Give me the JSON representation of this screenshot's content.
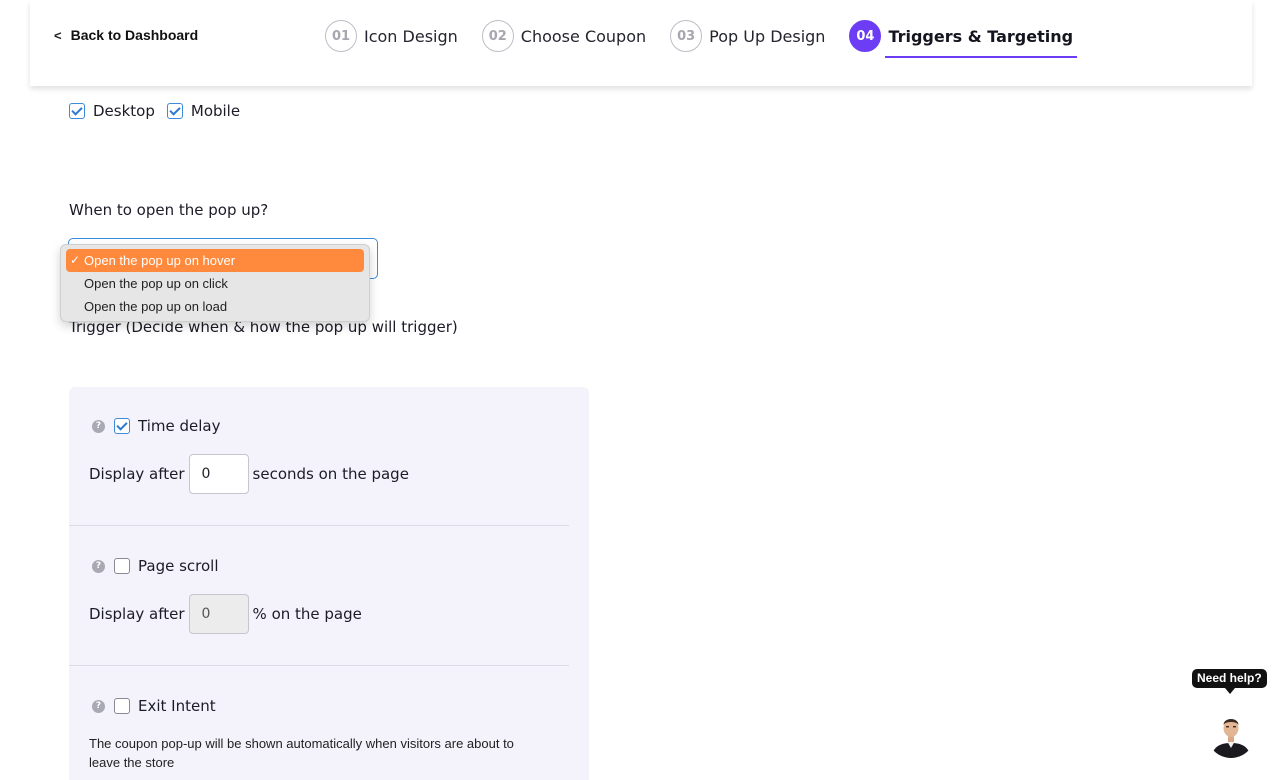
{
  "header": {
    "back_label": "Back to Dashboard",
    "steps": [
      {
        "num": "01",
        "label": "Icon Design"
      },
      {
        "num": "02",
        "label": "Choose Coupon"
      },
      {
        "num": "03",
        "label": "Pop Up Design"
      },
      {
        "num": "04",
        "label": "Triggers & Targeting"
      }
    ],
    "active_step": 3,
    "accent_color": "#6c3df5"
  },
  "devices": [
    {
      "label": "Desktop",
      "checked": true
    },
    {
      "label": "Mobile",
      "checked": true
    }
  ],
  "open_question": "When to open the pop up?",
  "open_select": {
    "options": [
      "Open the pop up on hover",
      "Open the pop up on click",
      "Open the pop up on load"
    ],
    "selected_index": 0,
    "tick": "✓",
    "highlight_color": "#ff8a3d"
  },
  "trigger_title": "Trigger (Decide when & how the pop up will trigger)",
  "triggers": {
    "help_glyph": "?",
    "time_delay": {
      "label": "Time delay",
      "checked": true,
      "prefix": "Display after",
      "value": "0",
      "suffix": "seconds on the page"
    },
    "page_scroll": {
      "label": "Page scroll",
      "checked": false,
      "prefix": "Display after",
      "value": "0",
      "suffix": "% on the page"
    },
    "exit_intent": {
      "label": "Exit Intent",
      "checked": false,
      "description": "The coupon pop-up will be shown automatically when visitors are about to leave the store"
    }
  },
  "help_widget": {
    "label": "Need help?"
  }
}
